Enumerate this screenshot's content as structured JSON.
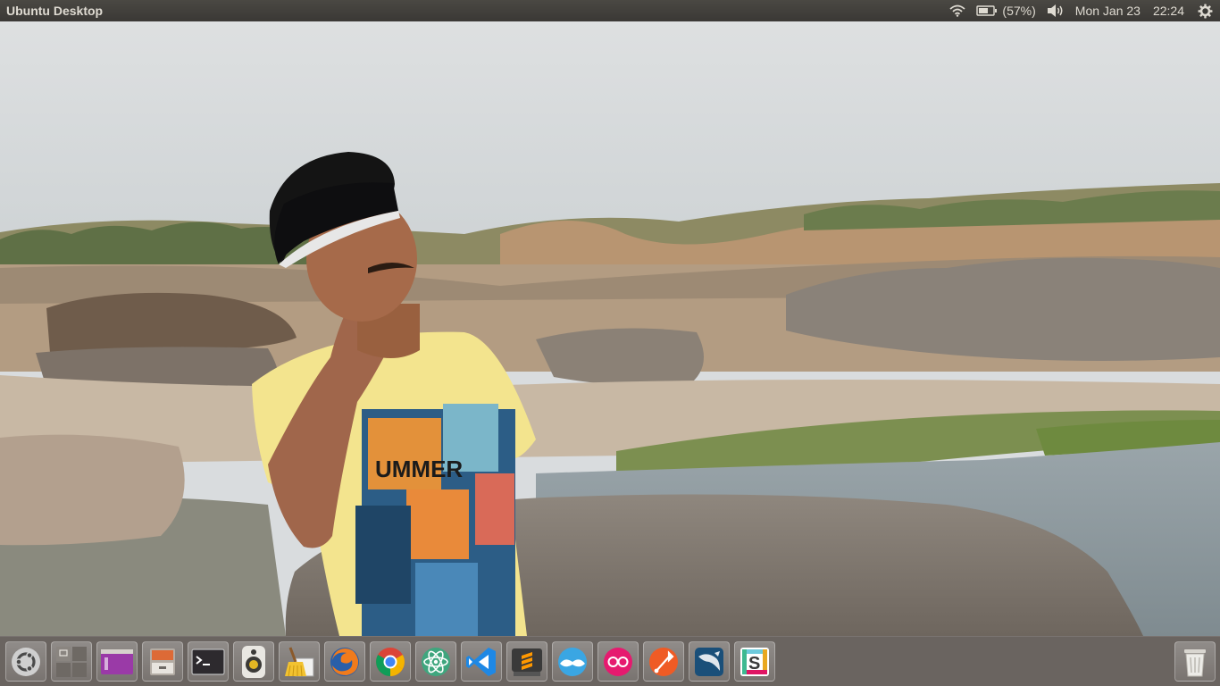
{
  "panel": {
    "app_title": "Ubuntu Desktop",
    "battery_percent": "(57%)",
    "date": "Mon Jan 23",
    "time": "22:24",
    "wifi_icon": "wifi-icon",
    "battery_icon": "battery-icon",
    "volume_icon": "volume-icon",
    "session_icon": "gear-icon"
  },
  "launcher": {
    "items": [
      {
        "name": "dash-button",
        "icon": "ubuntu-logo-icon"
      },
      {
        "name": "workspace-switcher",
        "icon": "workspace-grid-icon"
      },
      {
        "name": "emulator-window",
        "icon": "window-purple-icon"
      },
      {
        "name": "files",
        "icon": "file-cabinet-icon"
      },
      {
        "name": "terminal",
        "icon": "terminal-icon"
      },
      {
        "name": "rhythmbox",
        "icon": "speaker-icon"
      },
      {
        "name": "bleachbit",
        "icon": "broom-icon"
      },
      {
        "name": "firefox",
        "icon": "firefox-icon"
      },
      {
        "name": "chrome",
        "icon": "chrome-icon"
      },
      {
        "name": "atom",
        "icon": "atom-icon"
      },
      {
        "name": "vscode",
        "icon": "vscode-icon"
      },
      {
        "name": "sublime-text",
        "icon": "sublime-icon"
      },
      {
        "name": "franz",
        "icon": "mustache-icon"
      },
      {
        "name": "flickr",
        "icon": "flickr-icon"
      },
      {
        "name": "postman",
        "icon": "postman-icon"
      },
      {
        "name": "mysql-workbench",
        "icon": "dolphin-icon"
      },
      {
        "name": "slack",
        "icon": "slack-icon"
      }
    ],
    "trash_icon": "trash-icon"
  },
  "colors": {
    "panel_bg": "#3c3b37",
    "panel_text": "#dfdbd2",
    "launcher_bg": "#4a423c",
    "ubuntu_orange": "#dd4814"
  }
}
